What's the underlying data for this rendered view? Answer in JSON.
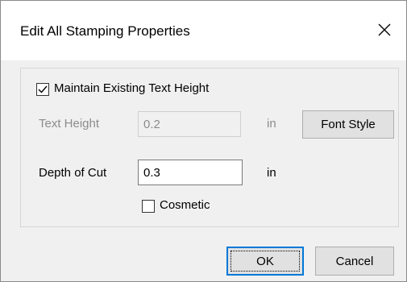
{
  "dialog": {
    "title": "Edit All Stamping Properties"
  },
  "options": {
    "maintain_text_height": {
      "label": "Maintain Existing Text Height",
      "checked": true
    },
    "text_height": {
      "label": "Text Height",
      "value": "0.2",
      "unit": "in",
      "disabled": true
    },
    "font_style_button": "Font Style",
    "depth_of_cut": {
      "label": "Depth of Cut",
      "value": "0.3",
      "unit": "in"
    },
    "cosmetic": {
      "label": "Cosmetic",
      "checked": false
    }
  },
  "buttons": {
    "ok": "OK",
    "cancel": "Cancel"
  }
}
